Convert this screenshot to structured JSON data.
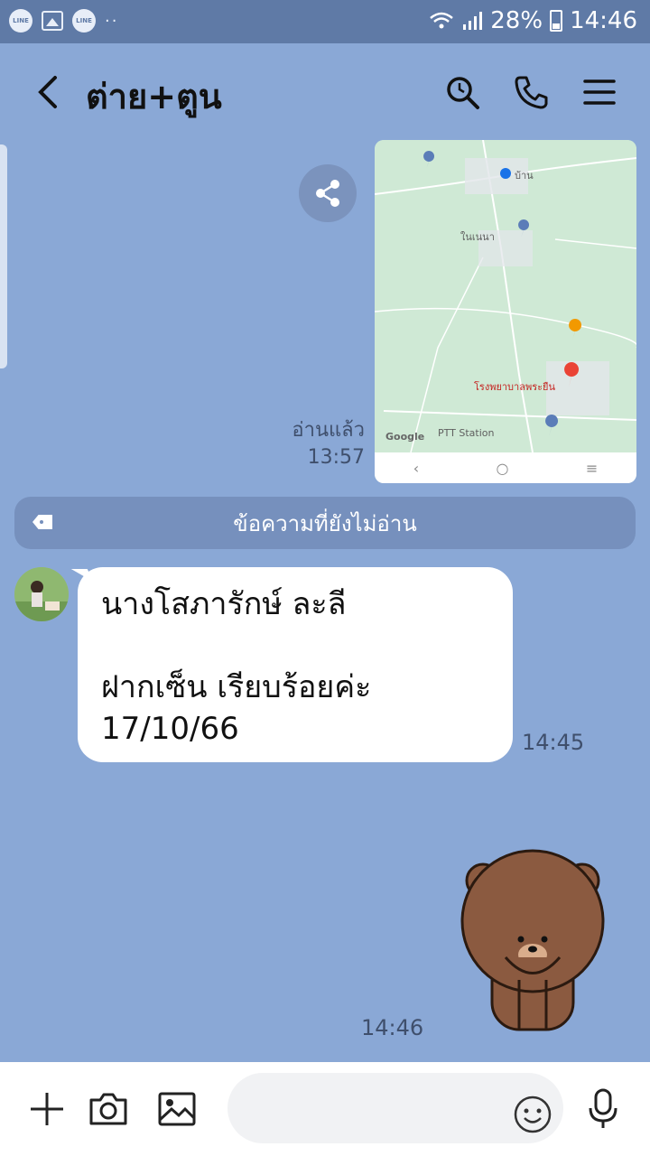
{
  "status_bar": {
    "app_icon_1": "LINE",
    "app_icon_2": "LINE",
    "dots": "··",
    "battery": "28%",
    "time": "14:46"
  },
  "header": {
    "title": "ต่าย+ตูน",
    "icons": [
      "back-icon",
      "search-icon",
      "phone-icon",
      "menu-icon"
    ]
  },
  "messages": {
    "map": {
      "labels": [
        "บ้าน",
        "ในเนนา",
        "โรงพยาบาลพระยืน",
        "PTT Station",
        "Google"
      ]
    },
    "read_label": "อ่านแล้ว",
    "map_time": "13:57",
    "unread_divider": "ข้อความที่ยังไม่อ่าน",
    "incoming": {
      "line1": "นางโสภารักษ์ ละลี",
      "line2": "ฝากเซ็น เรียบร้อยค่ะ",
      "line3": "17/10/66",
      "time": "14:45"
    },
    "sticker_time": "14:46"
  },
  "input_bar": {
    "placeholder": "",
    "icons": [
      "plus-icon",
      "camera-icon",
      "image-icon",
      "emoji-icon",
      "mic-icon"
    ]
  },
  "colors": {
    "background": "#8aa8d6",
    "status_bar": "#5f7aa6",
    "unread_bar": "#7690bd"
  }
}
